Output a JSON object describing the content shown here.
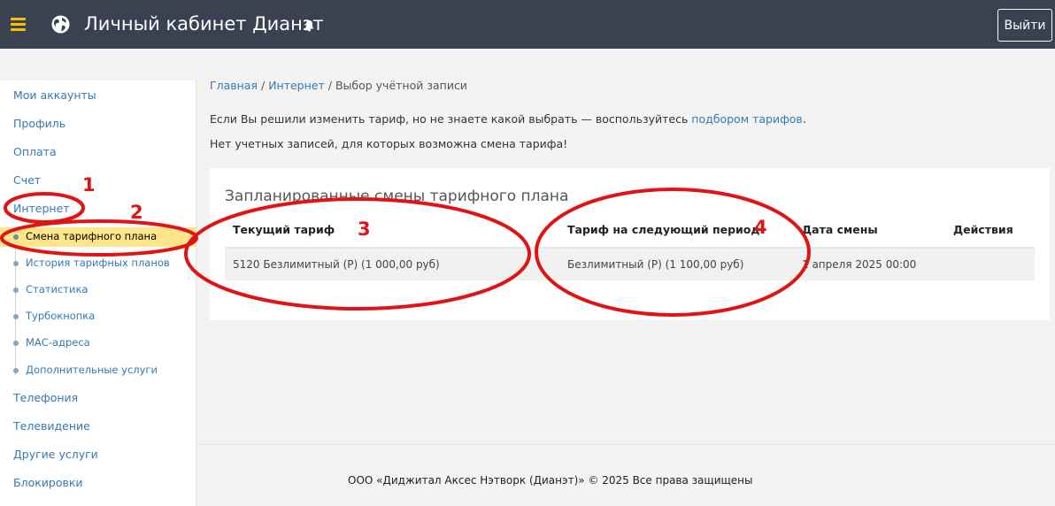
{
  "header": {
    "title": "Личный кабинет Дианэт",
    "logout_label": "Выйти"
  },
  "sidebar": {
    "items": [
      {
        "label": "Мои аккаунты"
      },
      {
        "label": "Профиль"
      },
      {
        "label": "Оплата"
      },
      {
        "label": "Счет"
      },
      {
        "label": "Интернет"
      }
    ],
    "subitems": [
      {
        "label": "Смена тарифного плана",
        "active": true
      },
      {
        "label": "История тарифных планов"
      },
      {
        "label": "Статистика"
      },
      {
        "label": "Турбокнопка"
      },
      {
        "label": "МАС-адреса"
      },
      {
        "label": "Дополнительные услуги"
      }
    ],
    "items_after": [
      {
        "label": "Телефония"
      },
      {
        "label": "Телевидение"
      },
      {
        "label": "Другие услуги"
      },
      {
        "label": "Блокировки"
      }
    ]
  },
  "breadcrumb": {
    "home": "Главная",
    "internet": "Интернет",
    "current": "Выбор учётной записи",
    "separator": "/"
  },
  "info": {
    "text_before_link": "Если Вы решили изменить тариф, но не знаете какой выбрать — воспользуйтесь ",
    "link": "подбором тарифов",
    "text_after_link": ".",
    "no_accounts": "Нет учетных записей, для которых возможна смена тарифа!"
  },
  "panel": {
    "title": "Запланированные смены тарифного плана",
    "columns": [
      "Текущий тариф",
      "Тариф на следующий период",
      "Дата смены",
      "Действия"
    ],
    "rows": [
      [
        "5120 Безлимитный (Р) (1 000,00 руб)",
        "Безлимитный (Р) (1 100,00 руб)",
        "1 апреля 2025 00:00",
        ""
      ]
    ]
  },
  "footer": {
    "text": "ООО «Диджитал Аксес Нэтворк (Дианэт)» © 2025 Все права защищены"
  },
  "annotations": [
    "1",
    "2",
    "3",
    "4"
  ],
  "colors": {
    "topbar": "#3a4150",
    "accent_yellow": "#f5c400",
    "active_bg": "#fde589",
    "link": "#337ab7",
    "annotation_red": "#e01414"
  }
}
